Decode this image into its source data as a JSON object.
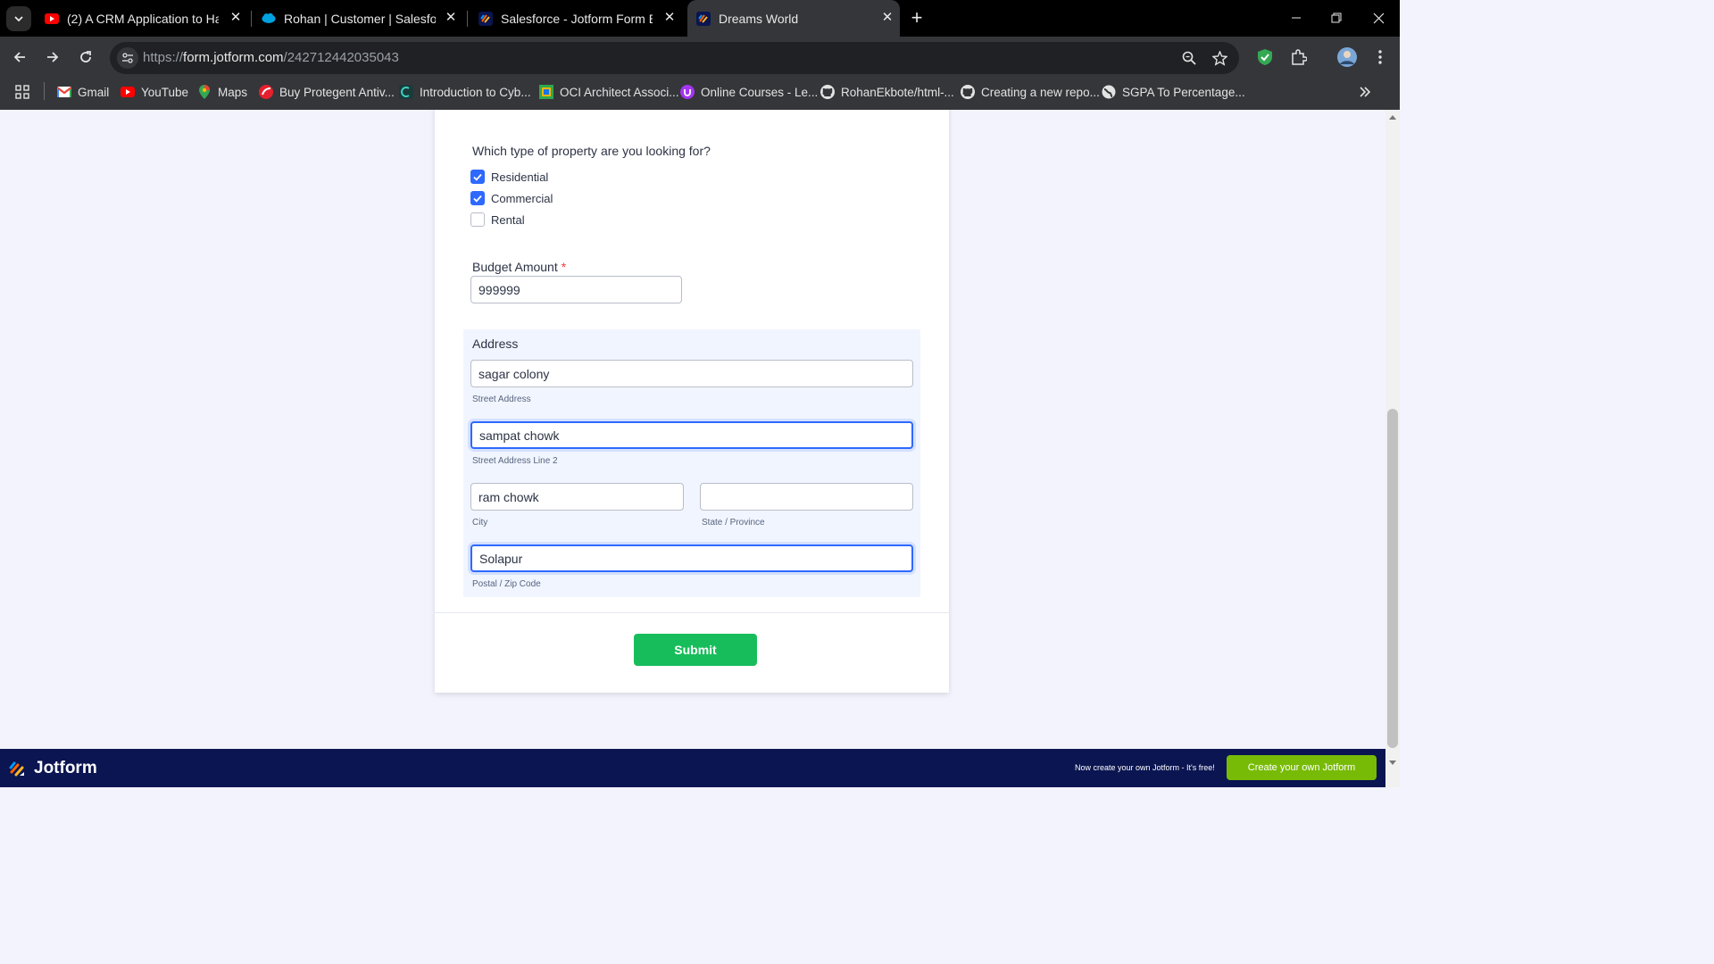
{
  "browser": {
    "tabs": [
      {
        "title": "(2) A CRM Application to Handl",
        "icon": "youtube-icon"
      },
      {
        "title": "Rohan | Customer | Salesforce",
        "icon": "salesforce-icon"
      },
      {
        "title": "Salesforce - Jotform Form Build",
        "icon": "jotform-icon"
      },
      {
        "title": "Dreams World",
        "icon": "jotform-icon",
        "active": true
      }
    ],
    "url": {
      "scheme": "https://",
      "host": "form.jotform.com",
      "path": "/242712442035043"
    },
    "bookmarks": [
      {
        "label": "Gmail",
        "icon": "gmail-icon"
      },
      {
        "label": "YouTube",
        "icon": "youtube-icon"
      },
      {
        "label": "Maps",
        "icon": "maps-icon"
      },
      {
        "label": "Buy Protegent Antiv...",
        "icon": "protegent-icon"
      },
      {
        "label": "Introduction to Cyb...",
        "icon": "course-icon"
      },
      {
        "label": "OCI Architect Associ...",
        "icon": "oci-icon"
      },
      {
        "label": "Online Courses - Le...",
        "icon": "udemy-icon"
      },
      {
        "label": "RohanEkbote/html-...",
        "icon": "github-icon"
      },
      {
        "label": "Creating a new repo...",
        "icon": "github-icon"
      },
      {
        "label": "SGPA To Percentage...",
        "icon": "globe-icon"
      }
    ]
  },
  "form": {
    "property_question": "Which type of property are you looking for?",
    "property_options": [
      {
        "label": "Residential",
        "checked": true
      },
      {
        "label": "Commercial",
        "checked": true
      },
      {
        "label": "Rental",
        "checked": false
      }
    ],
    "budget": {
      "label": "Budget Amount",
      "required_mark": "*",
      "value": "999999"
    },
    "address": {
      "label": "Address",
      "street": {
        "value": "sagar colony",
        "sublabel": "Street Address"
      },
      "street2": {
        "value": "sampat chowk",
        "sublabel": "Street Address Line 2"
      },
      "city": {
        "value": "ram chowk",
        "sublabel": "City"
      },
      "state": {
        "value": "",
        "sublabel": "State / Province"
      },
      "zip": {
        "value": "Solapur",
        "sublabel": "Postal / Zip Code"
      }
    },
    "submit_label": "Submit"
  },
  "footer": {
    "brand": "Jotform",
    "promo_text": "Now create your own Jotform - It's free!",
    "cta_label": "Create your own Jotform"
  },
  "colors": {
    "accent_blue": "#2e69ff",
    "submit_green": "#18bd5b",
    "footer_navy": "#0a1551",
    "cta_green": "#78bb07"
  }
}
